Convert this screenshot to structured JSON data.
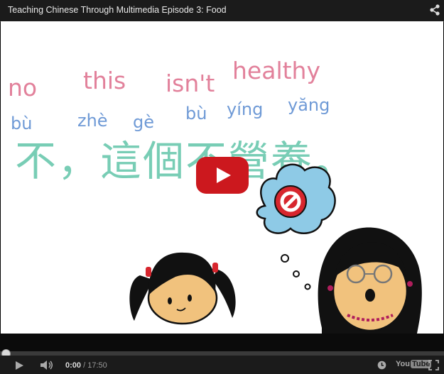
{
  "window": {
    "title": "Teaching Chinese Through Multimedia Episode 3: Food",
    "share_icon": "share-icon"
  },
  "video": {
    "english_words": [
      "no",
      "this",
      "isn't",
      "healthy"
    ],
    "pinyin": [
      "bù",
      "zhè",
      "gè",
      "bù",
      "yíng",
      "yăng"
    ],
    "chinese": "不，這個不營養。",
    "colors": {
      "english": "#e2819b",
      "pinyin": "#6f9ad6",
      "chinese": "#78cdb5",
      "play": "#cc181e"
    }
  },
  "controls": {
    "current_time": "0:00",
    "separator": " / ",
    "duration": "17:50",
    "progress": 0,
    "logo_you": "You",
    "logo_tube": "Tube",
    "icons": [
      "play-icon",
      "volume-icon",
      "watch-later-icon",
      "fullscreen-icon"
    ]
  }
}
